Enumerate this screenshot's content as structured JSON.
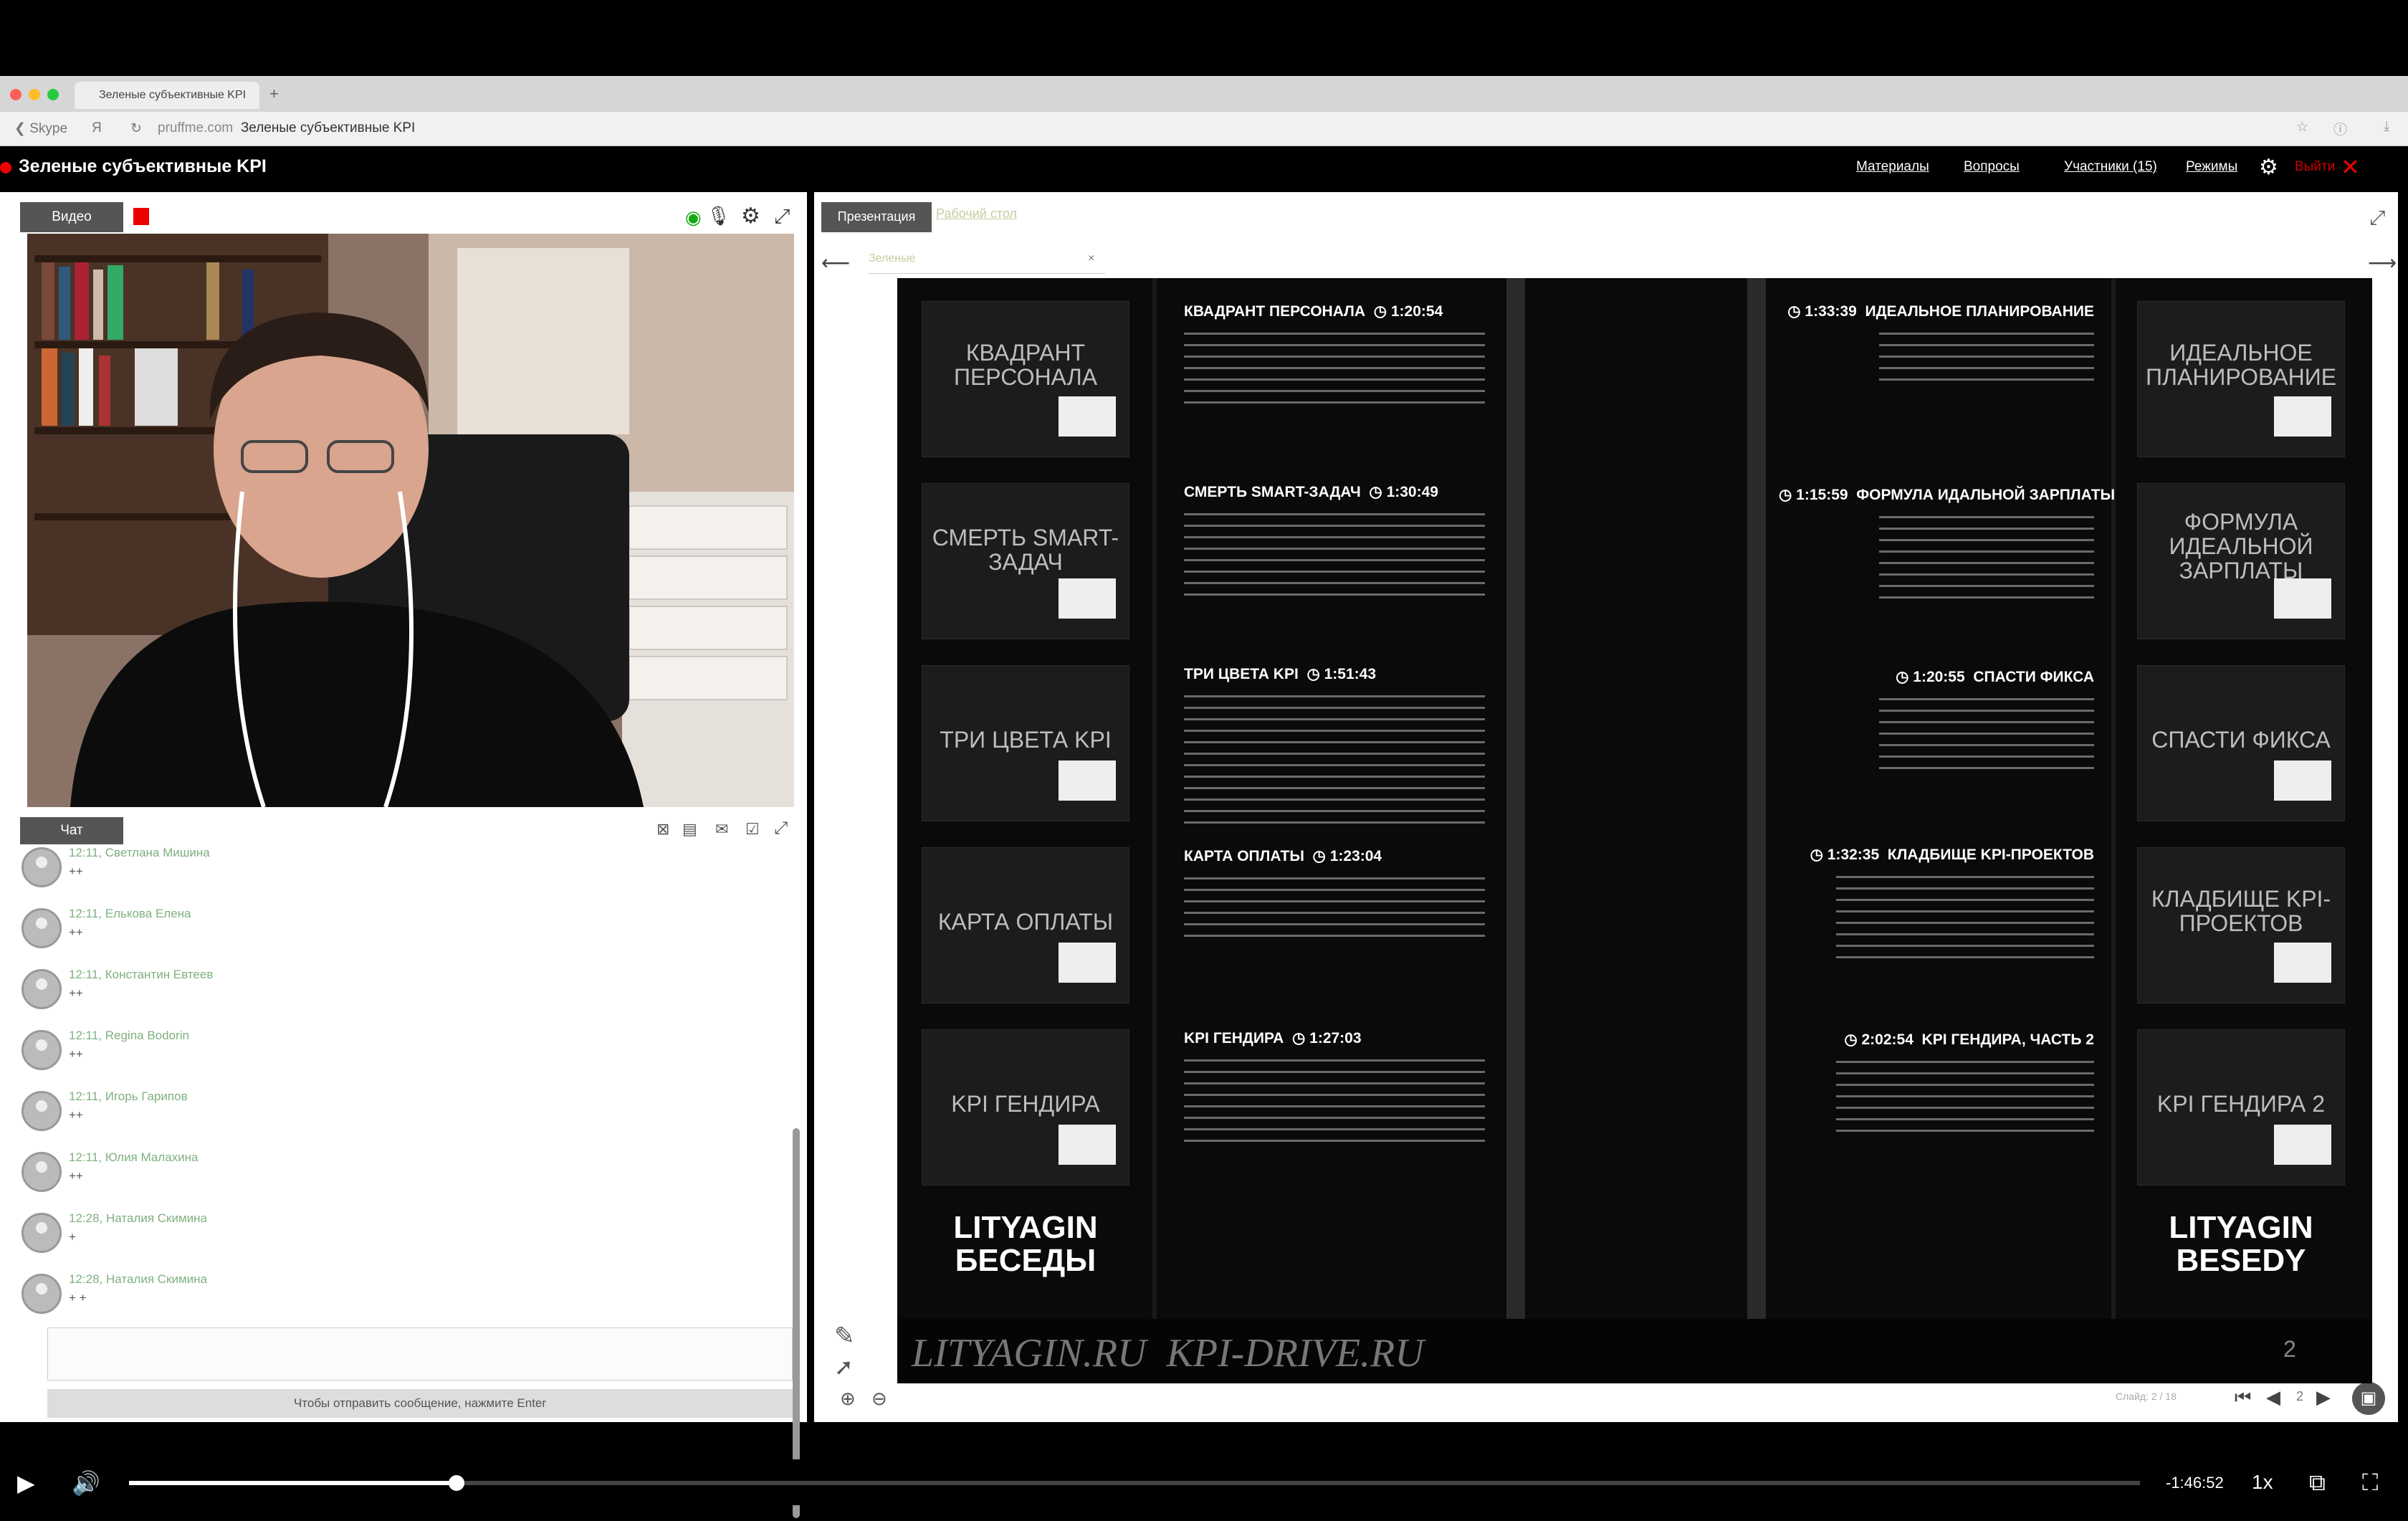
{
  "browser": {
    "tab_title": "Зеленые субъективные KPI",
    "back_label": "Skype",
    "url_domain": "pruffme.com",
    "url_title": "Зеленые субъективные KPI"
  },
  "app": {
    "title": "Зеленые субъективные KPI",
    "nav": [
      "Материалы",
      "Вопросы",
      "Участники (15)",
      "Режимы"
    ],
    "exit_label": "Выйти"
  },
  "video": {
    "tab_label": "Видео"
  },
  "chat": {
    "tab_label": "Чат",
    "messages": [
      {
        "time": "12:11",
        "name": "Светлана Мишина",
        "text": "++"
      },
      {
        "time": "12:11",
        "name": "Елькова Елена",
        "text": "++"
      },
      {
        "time": "12:11",
        "name": "Константин Евтеев",
        "text": "++"
      },
      {
        "time": "12:11",
        "name": "Regina Bodorin",
        "text": "++"
      },
      {
        "time": "12:11",
        "name": "Игорь Гарипов",
        "text": "++"
      },
      {
        "time": "12:11",
        "name": "Юлия Малахина",
        "text": "++"
      },
      {
        "time": "12:28",
        "name": "Наталия Скимина",
        "text": "+"
      },
      {
        "time": "12:28",
        "name": "Наталия Скимина",
        "text": "+ +"
      }
    ],
    "send_hint": "Чтобы отправить сообщение, нажмите Enter"
  },
  "presentation": {
    "tabs": [
      "Презентация",
      "Рабочий стол"
    ],
    "file_tab": "Зеленые",
    "slide_counter_label": "Слайд: 2 / 18",
    "page_number": "2"
  },
  "slide": {
    "left_items": [
      {
        "thumb": "КВАДРАНТ ПЕРСОНАЛА",
        "title": "КВАДРАНТ ПЕРСОНАЛА",
        "time": "1:20:54"
      },
      {
        "thumb": "СМЕРТЬ SMART-ЗАДАЧ",
        "title": "СМЕРТЬ SMART-ЗАДАЧ",
        "time": "1:30:49"
      },
      {
        "thumb": "ТРИ ЦВЕТА KPI",
        "title": "ТРИ ЦВЕТА KPI",
        "time": "1:51:43"
      },
      {
        "thumb": "КАРТА ОПЛАТЫ",
        "title": "КАРТА ОПЛАТЫ",
        "time": "1:23:04"
      },
      {
        "thumb": "KPI ГЕНДИРА",
        "title": "KPI ГЕНДИРА",
        "time": "1:27:03"
      }
    ],
    "right_items": [
      {
        "thumb": "ИДЕАЛЬНОЕ ПЛАНИРОВАНИЕ",
        "title": "ИДЕАЛЬНОЕ ПЛАНИРОВАНИЕ",
        "time": "1:33:39"
      },
      {
        "thumb": "ФОРМУЛА ИДЕАЛЬНОЙ ЗАРПЛАТЫ",
        "title": "ФОРМУЛА ИДАЛЬНОЙ ЗАРПЛАТЫ",
        "time": "1:15:59"
      },
      {
        "thumb": "СПАСТИ ФИКСА",
        "title": "СПАСТИ ФИКСА",
        "time": "1:20:55"
      },
      {
        "thumb": "КЛАДБИЩЕ KPI-ПРОЕКТОВ",
        "title": "КЛАДБИЩЕ KPI-ПРОЕКТОВ",
        "time": "1:32:35"
      },
      {
        "thumb": "KPI ГЕНДИРА 2",
        "title": "KPI ГЕНДИРА, ЧАСТЬ 2",
        "time": "2:02:54"
      }
    ],
    "logo_left": [
      "LITYAGIN",
      "БЕСЕДЫ"
    ],
    "logo_right": [
      "LITYAGIN",
      "BESEDY"
    ],
    "footer": "LITYAGIN.RU  KPI-DRIVE.RU"
  },
  "player": {
    "time_remaining": "-1:46:52",
    "speed": "1x",
    "progress_fraction": 0.163
  }
}
